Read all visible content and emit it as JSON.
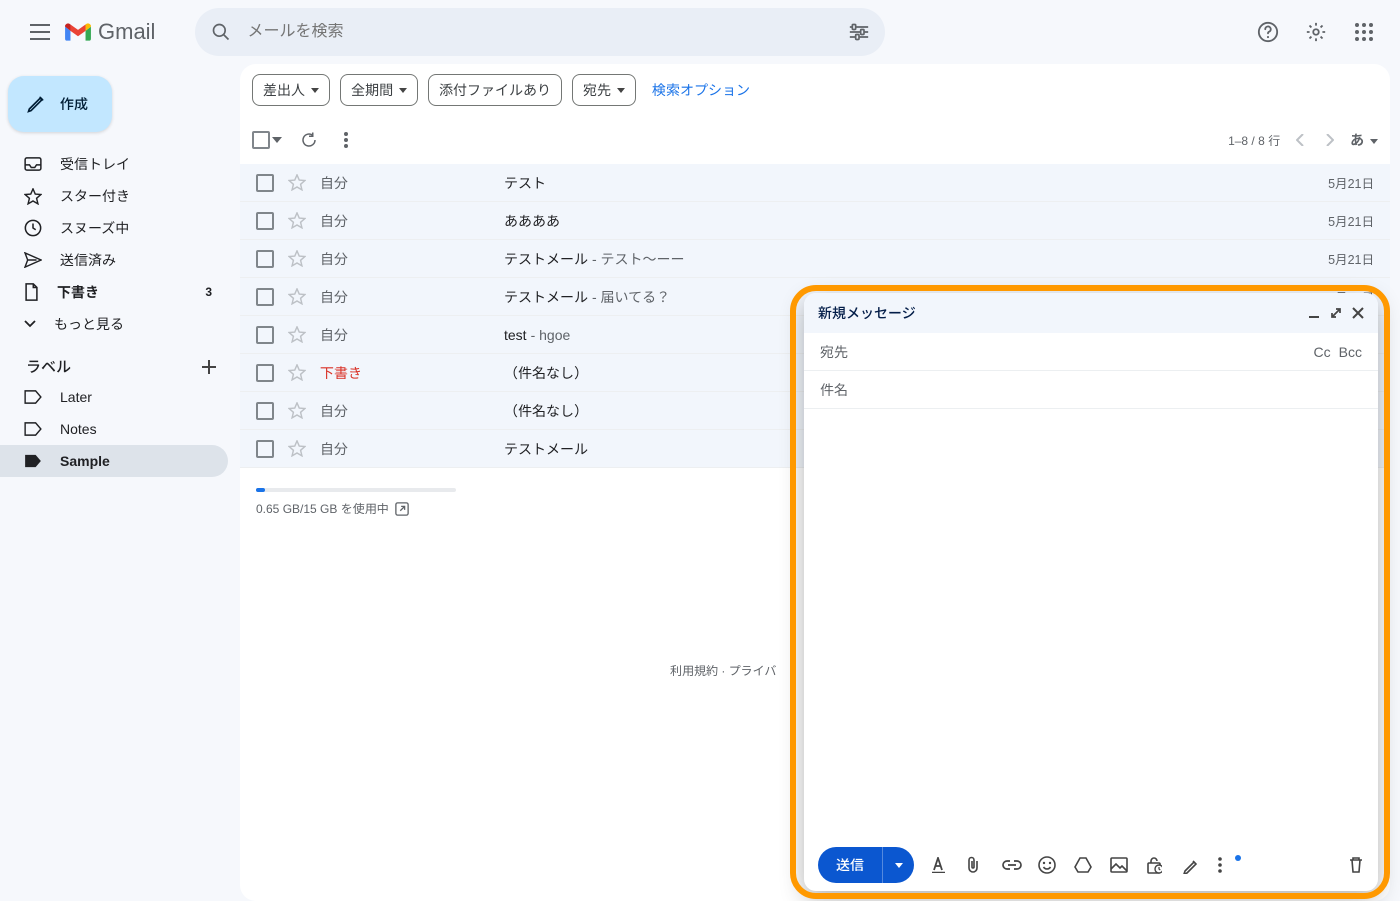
{
  "header": {
    "app_name": "Gmail",
    "search_placeholder": "メールを検索"
  },
  "compose_button": "作成",
  "nav": [
    {
      "icon": "inbox",
      "label": "受信トレイ",
      "count": ""
    },
    {
      "icon": "star",
      "label": "スター付き",
      "count": ""
    },
    {
      "icon": "clock",
      "label": "スヌーズ中",
      "count": ""
    },
    {
      "icon": "send",
      "label": "送信済み",
      "count": ""
    },
    {
      "icon": "draft",
      "label": "下書き",
      "count": "3",
      "bold": true
    },
    {
      "icon": "more",
      "label": "もっと見る",
      "count": ""
    }
  ],
  "labels_header": "ラベル",
  "labels": [
    {
      "name": "Later",
      "active": false
    },
    {
      "name": "Notes",
      "active": false
    },
    {
      "name": "Sample",
      "active": true
    }
  ],
  "filter_chips": [
    "差出人",
    "全期間",
    "添付ファイルあり",
    "宛先"
  ],
  "search_options": "検索オプション",
  "pager": "1–8 / 8 行",
  "lang": "あ",
  "rows": [
    {
      "sender": "自分",
      "subject": "テスト",
      "preview": "",
      "date": "5月21日"
    },
    {
      "sender": "自分",
      "subject": "ああああ",
      "preview": "",
      "date": "5月21日"
    },
    {
      "sender": "自分",
      "subject": "テストメール",
      "preview": " - テスト〜ーー",
      "date": "5月21日"
    },
    {
      "sender": "自分",
      "subject": "テストメール",
      "preview": " - 届いてる？",
      "date": "5月21日"
    },
    {
      "sender": "自分",
      "subject": "test",
      "preview": " - hgoe",
      "date": ""
    },
    {
      "sender": "下書き",
      "subject": "（件名なし）",
      "preview": "",
      "date": "",
      "draft": true
    },
    {
      "sender": "自分",
      "subject": "（件名なし）",
      "preview": "",
      "date": ""
    },
    {
      "sender": "自分",
      "subject": "テストメール",
      "preview": "",
      "date": ""
    }
  ],
  "storage": "0.65 GB/15 GB を使用中",
  "footer_links": "利用規約 · プライバ",
  "compose": {
    "title": "新規メッセージ",
    "to_label": "宛先",
    "cc": "Cc",
    "bcc": "Bcc",
    "subject_placeholder": "件名",
    "send": "送信"
  }
}
